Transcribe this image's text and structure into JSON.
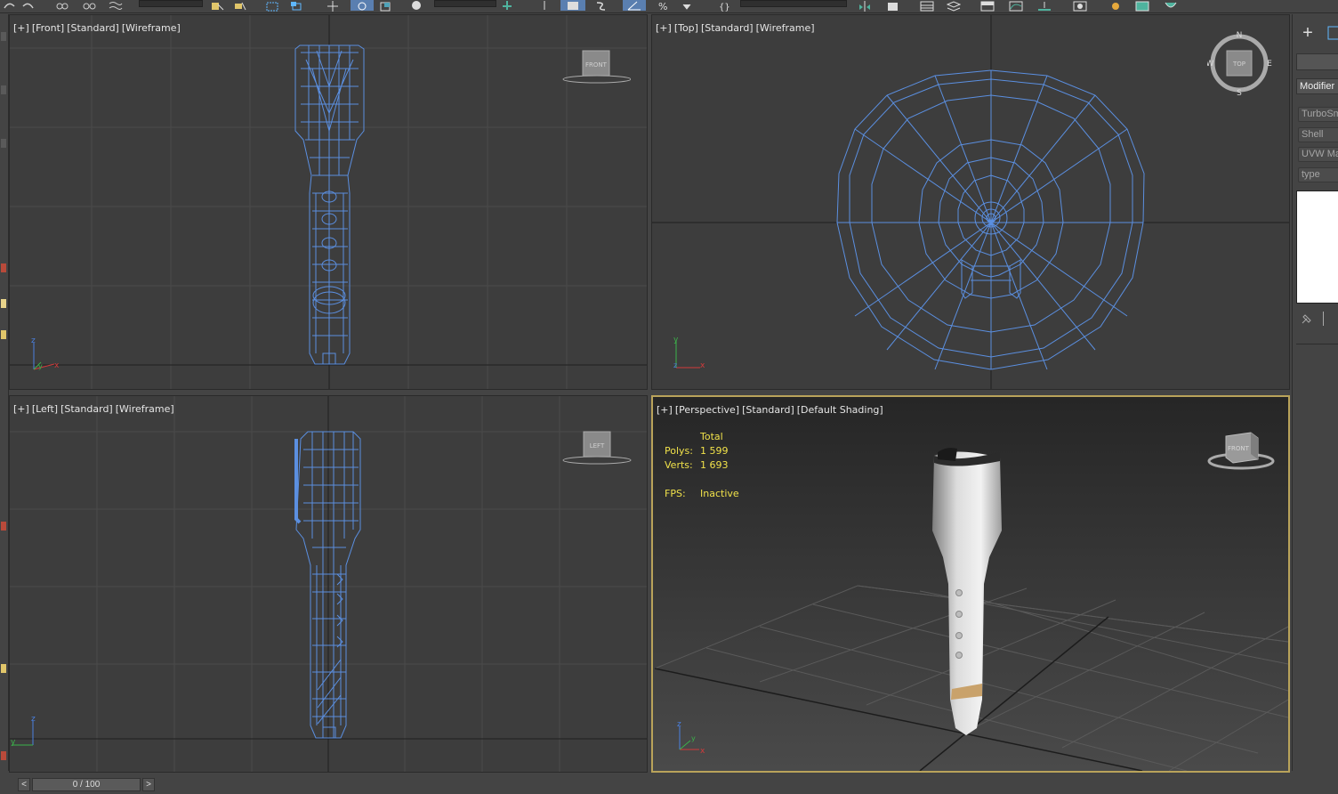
{
  "viewports": {
    "front": {
      "plus": "[+]",
      "view": "[Front]",
      "preset": "[Standard]",
      "shading": "[Wireframe]",
      "cube": "FRONT"
    },
    "top": {
      "plus": "[+]",
      "view": "[Top]",
      "preset": "[Standard]",
      "shading": "[Wireframe]",
      "cube": "TOP",
      "compass": {
        "n": "N",
        "s": "S",
        "e": "E",
        "w": "W"
      }
    },
    "left": {
      "plus": "[+]",
      "view": "[Left]",
      "preset": "[Standard]",
      "shading": "[Wireframe]",
      "cube": "LEFT"
    },
    "perspective": {
      "plus": "[+]",
      "view": "[Perspective]",
      "preset": "[Standard]",
      "shading": "[Default Shading]",
      "cube": "FRONT"
    }
  },
  "stats": {
    "total_label": "Total",
    "polys_label": "Polys:",
    "polys_value": "1 599",
    "verts_label": "Verts:",
    "verts_value": "1 693",
    "fps_label": "FPS:",
    "fps_value": "Inactive"
  },
  "axes": {
    "x": "x",
    "y": "y",
    "z": "z"
  },
  "command_panel": {
    "create_icon": "+",
    "modifier_list": "Modifier List",
    "buttons": [
      "TurboSmooth",
      "Shell",
      "UVW Map",
      "type"
    ]
  },
  "timeline": {
    "prev": "<",
    "next": ">",
    "frame": "0 / 100"
  },
  "colors": {
    "wireframe": "#5b8fe0",
    "viewport_bg": "#3d3d3d",
    "active_border": "#b9a35a",
    "stats_text": "#f0e14a"
  }
}
